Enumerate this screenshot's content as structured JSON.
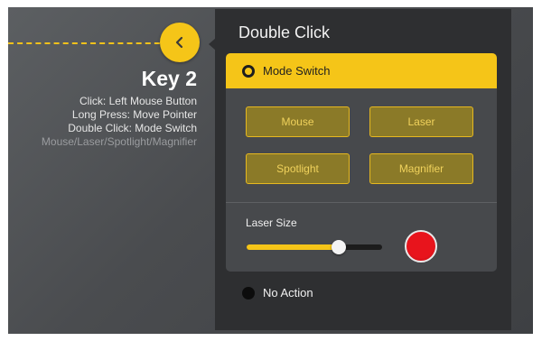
{
  "key": {
    "title": "Key 2",
    "lines": [
      "Click: Left Mouse Button",
      "Long Press: Move Pointer",
      "Double Click: Mode Switch",
      "Mouse/Laser/Spotlight/Magnifier"
    ]
  },
  "panel": {
    "title": "Double Click",
    "mode_switch": {
      "label": "Mode Switch",
      "selected": true,
      "buttons": [
        "Mouse",
        "Laser",
        "Spotlight",
        "Magnifier"
      ],
      "laser_size": {
        "label": "Laser Size",
        "value_fraction": 0.68,
        "color": "#e8141c"
      }
    },
    "no_action": {
      "label": "No Action",
      "selected": false
    }
  },
  "colors": {
    "accent": "#f5c518",
    "panel_bg": "#2e2f31",
    "card_bg": "#47494c"
  },
  "icons": {
    "back": "chevron-left-icon"
  }
}
